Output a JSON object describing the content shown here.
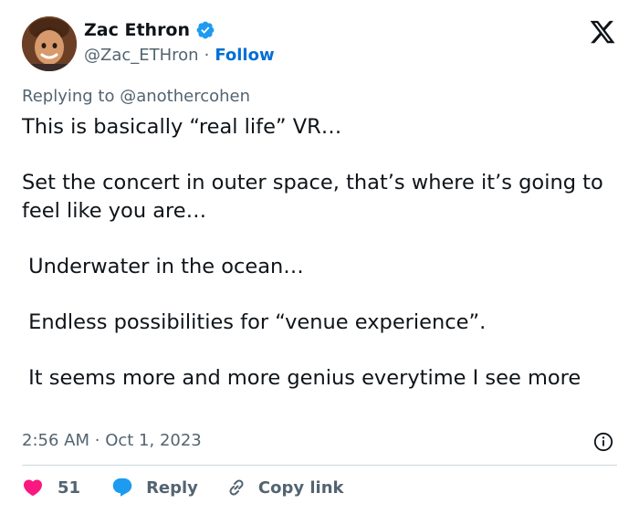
{
  "author": {
    "name": "Zac Ethron",
    "handle": "@Zac_ETHron",
    "separator": "·",
    "follow_label": "Follow",
    "avatar_icon": "cartoon-avatar"
  },
  "reply_context": {
    "prefix": "Replying to ",
    "mention": "@anothercohen"
  },
  "tweet": {
    "paragraphs": [
      "This is basically “real life” VR…",
      "Set the concert in outer space, that’s where it’s going to feel like you are…",
      " Underwater in the ocean…",
      " Endless possibilities for “venue experience”.",
      " It seems more and more genius everytime I see more"
    ]
  },
  "timestamp": {
    "time": "2:56 AM",
    "separator": "·",
    "date": "Oct 1, 2023"
  },
  "actions": {
    "likes": "51",
    "reply_label": "Reply",
    "copy_link_label": "Copy link"
  },
  "colors": {
    "verified": "#1d9bf0",
    "follow": "#006fd6",
    "heart": "#f91880",
    "reply_bubble": "#1d9bf0"
  }
}
